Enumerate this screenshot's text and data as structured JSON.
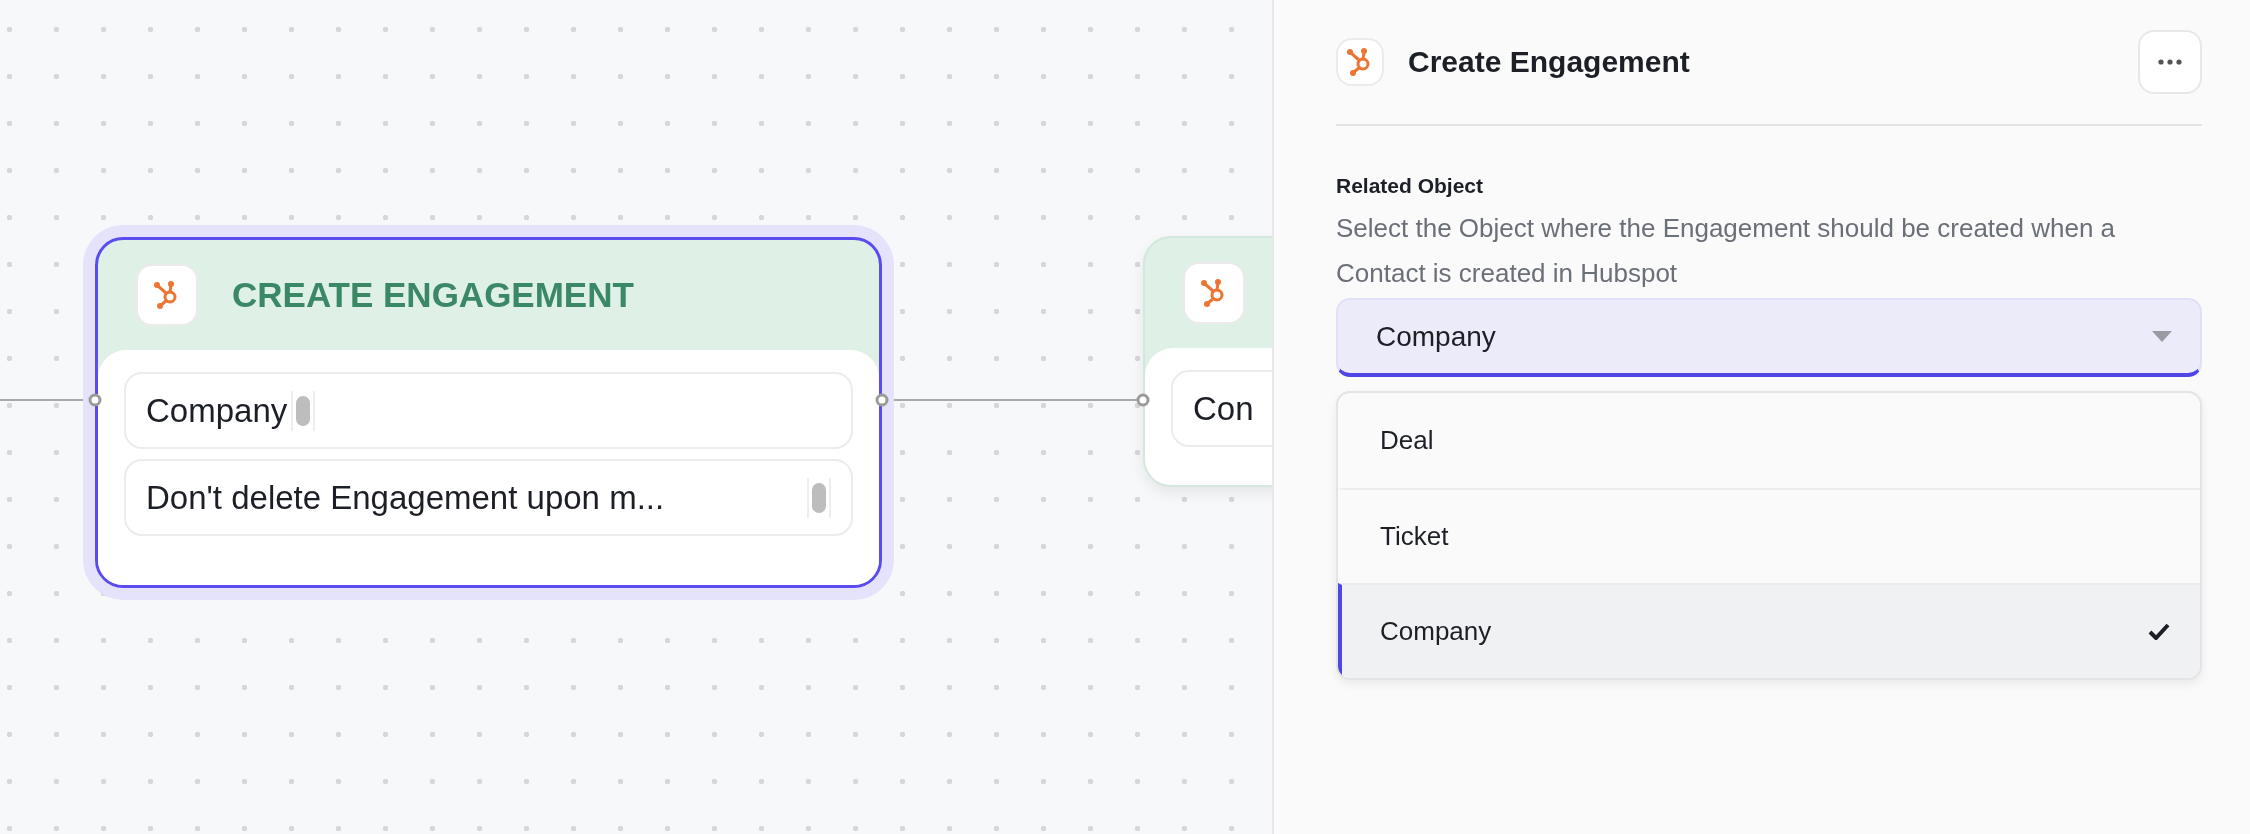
{
  "canvas": {
    "nodes": [
      {
        "title": "CREATE ENGAGEMENT",
        "selected": true,
        "fields": [
          "Company",
          "Don't delete Engagement upon m..."
        ]
      },
      {
        "selected": false,
        "fields": [
          "Con"
        ]
      }
    ]
  },
  "panel": {
    "title": "Create Engagement",
    "field": {
      "label": "Related Object",
      "description": "Select the Object where the Engagement should be created when a Contact is created in Hubspot",
      "value": "Company",
      "expanded": true,
      "options": [
        {
          "label": "Deal",
          "selected": false
        },
        {
          "label": "Ticket",
          "selected": false
        },
        {
          "label": "Company",
          "selected": true
        }
      ]
    }
  }
}
